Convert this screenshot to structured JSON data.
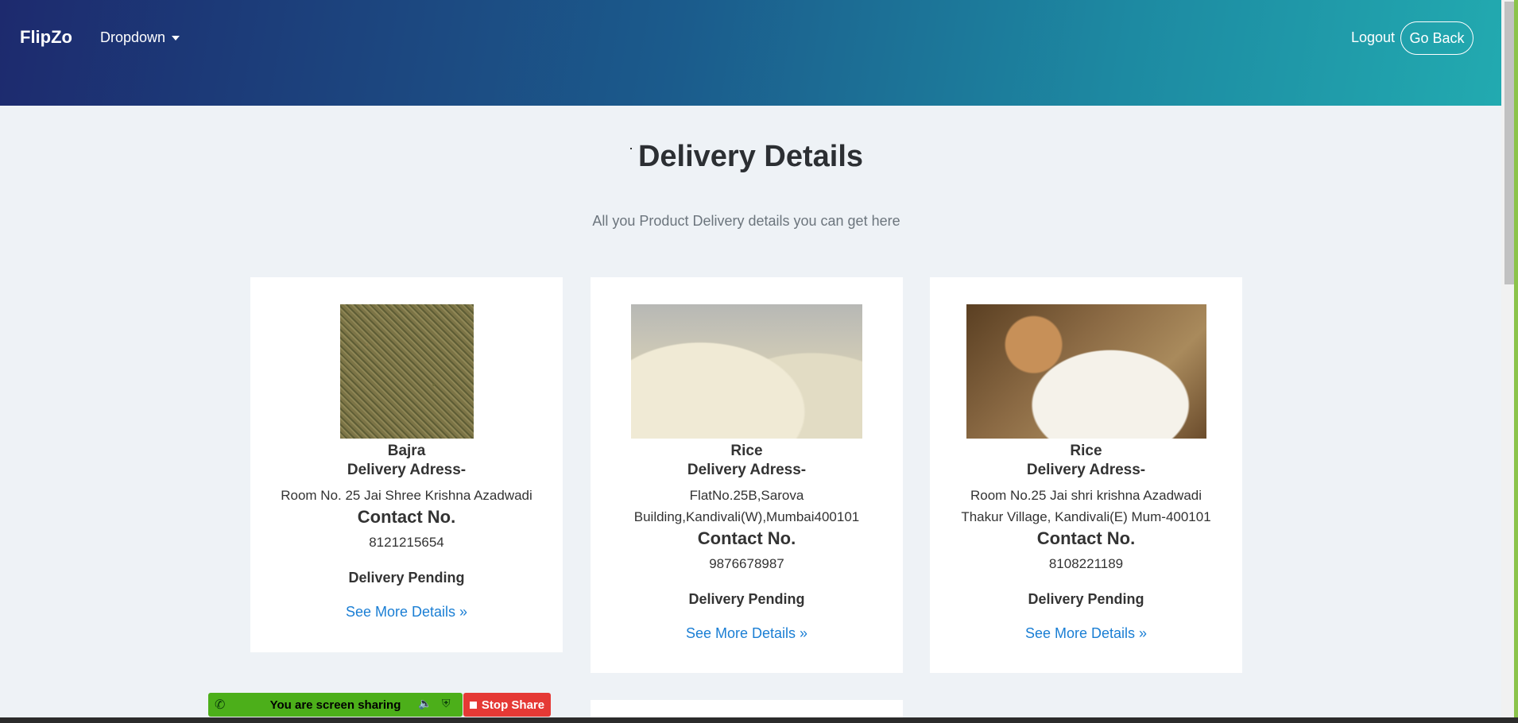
{
  "navbar": {
    "brand": "FlipZo",
    "dropdown_label": "Dropdown",
    "logout_label": "Logout",
    "go_back_label": "Go Back"
  },
  "header": {
    "title": "Delivery Details",
    "subtitle": "All you Product Delivery details you can get here"
  },
  "cards": [
    {
      "product": "Bajra",
      "address_label": "Delivery Adress-",
      "address": "Room No. 25 Jai Shree Krishna Azadwadi",
      "contact_label": "Contact No.",
      "contact": "8121215654",
      "status": "Delivery Pending",
      "more_link": "See More Details »"
    },
    {
      "product": "Rice",
      "address_label": "Delivery Adress-",
      "address": "FlatNo.25B,Sarova Building,Kandivali(W),Mumbai400101",
      "contact_label": "Contact No.",
      "contact": "9876678987",
      "status": "Delivery Pending",
      "more_link": "See More Details »"
    },
    {
      "product": "Rice",
      "address_label": "Delivery Adress-",
      "address": "Room No.25 Jai shri krishna Azadwadi Thakur Village, Kandivali(E) Mum-400101",
      "contact_label": "Contact No.",
      "contact": "8108221189",
      "status": "Delivery Pending",
      "more_link": "See More Details »"
    }
  ],
  "screenshare": {
    "sharing_text": "You are screen sharing",
    "stop_label": "Stop Share"
  },
  "colors": {
    "link": "#1a7ed4",
    "share_bar": "#4caf1a",
    "stop_button": "#e53935"
  }
}
